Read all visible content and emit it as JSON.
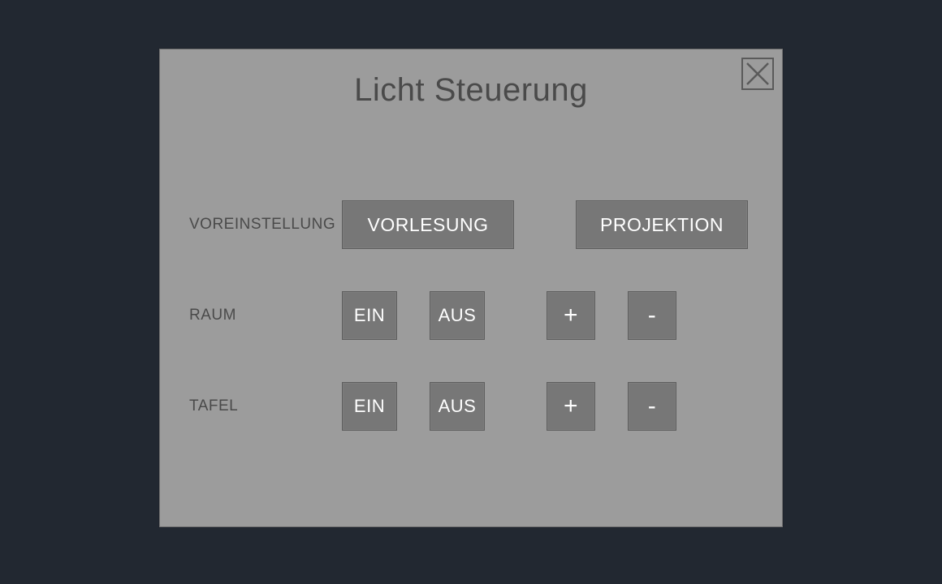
{
  "dialog": {
    "title": "Licht Steuerung"
  },
  "preset": {
    "label": "VOREINSTELLUNG",
    "lecture": "VORLESUNG",
    "projection": "PROJEKTION"
  },
  "room": {
    "label": "RAUM",
    "on": "EIN",
    "off": "AUS",
    "plus": "+",
    "minus": "-"
  },
  "board": {
    "label": "TAFEL",
    "on": "EIN",
    "off": "AUS",
    "plus": "+",
    "minus": "-"
  }
}
